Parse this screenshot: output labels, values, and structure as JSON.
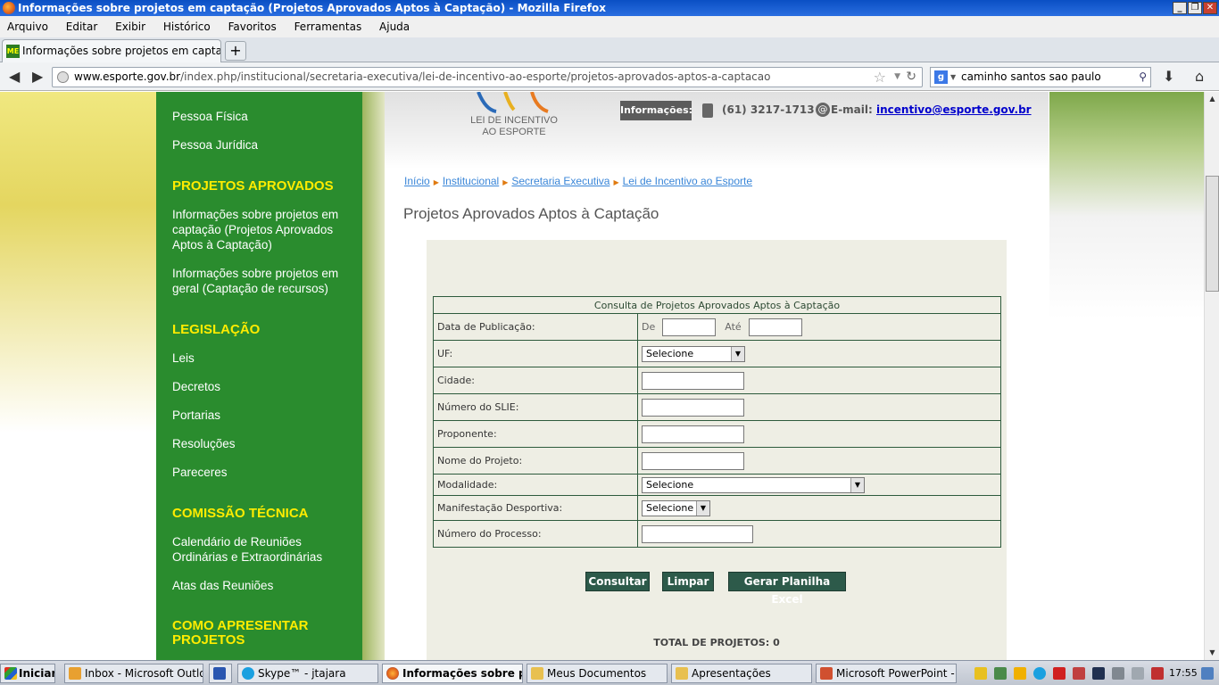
{
  "window": {
    "title": "Informações sobre projetos em captação (Projetos Aprovados Aptos à Captação) - Mozilla Firefox"
  },
  "menu": [
    "Arquivo",
    "Editar",
    "Exibir",
    "Histórico",
    "Favoritos",
    "Ferramentas",
    "Ajuda"
  ],
  "tab": {
    "favicon": "ME",
    "label": "Informações sobre projetos em captação (Pr..."
  },
  "url": {
    "domain": "www.esporte.gov.br",
    "path": "/index.php/institucional/secretaria-executiva/lei-de-incentivo-ao-esporte/projetos-aprovados-aptos-a-captacao"
  },
  "search": {
    "engine_icon": "g",
    "value": "caminho santos sao paulo"
  },
  "header": {
    "logo_line1": "LEI DE INCENTIVO",
    "logo_line2": "AO ESPORTE",
    "info_label": "Informações:",
    "phone": "(61) 3217-1713",
    "email_label": "E-mail:",
    "email": "incentivo@esporte.gov.br"
  },
  "sidebar": {
    "items_top": [
      "Pessoa Física",
      "Pessoa Jurídica"
    ],
    "sec_projetos": "PROJETOS APROVADOS",
    "projetos": [
      "Informações sobre projetos em captação (Projetos Aprovados Aptos à Captação)",
      "Informações sobre projetos em geral (Captação de recursos)"
    ],
    "sec_legislacao": "LEGISLAÇÃO",
    "legislacao": [
      "Leis",
      "Decretos",
      "Portarias",
      "Resoluções",
      "Pareceres"
    ],
    "sec_comissao": "COMISSÃO TÉCNICA",
    "comissao": [
      "Calendário de Reuniões Ordinárias e Extraordinárias",
      "Atas das Reuniões"
    ],
    "sec_como": "COMO APRESENTAR PROJETOS"
  },
  "breadcrumb": [
    "Início",
    "Institucional",
    "Secretaria Executiva",
    "Lei de Incentivo ao Esporte"
  ],
  "page_title": "Projetos Aprovados Aptos à Captação",
  "form": {
    "caption": "Consulta de Projetos Aprovados Aptos à Captação",
    "data_publicacao": "Data de Publicação:",
    "de": "De",
    "ate": "Até",
    "uf": "UF:",
    "uf_value": "Selecione",
    "cidade": "Cidade:",
    "numero_slie": "Número do SLIE:",
    "proponente": "Proponente:",
    "nome_projeto": "Nome do Projeto:",
    "modalidade": "Modalidade:",
    "modalidade_value": "Selecione",
    "manifestacao": "Manifestação Desportiva:",
    "manifestacao_value": "Selecione",
    "numero_processo": "Número do Processo:",
    "btn_consultar": "Consultar",
    "btn_limpar": "Limpar",
    "btn_excel": "Gerar Planilha Excel",
    "total": "TOTAL DE PROJETOS: 0"
  },
  "taskbar": {
    "start": "Iniciar",
    "items": [
      "Inbox - Microsoft Outlook",
      "Skype™ - jtajara",
      "Informações sobre pr...",
      "Meus Documentos",
      "Apresentações",
      "Microsoft PowerPoint - [..."
    ],
    "clock": "17:55"
  },
  "colors": {
    "sidebar_bg": "#2a8c2e",
    "sidebar_heading": "#ffec00",
    "form_border": "#2d5a3c",
    "button_bg": "#2d5a4a",
    "titlebar": "#0a4fc4"
  }
}
